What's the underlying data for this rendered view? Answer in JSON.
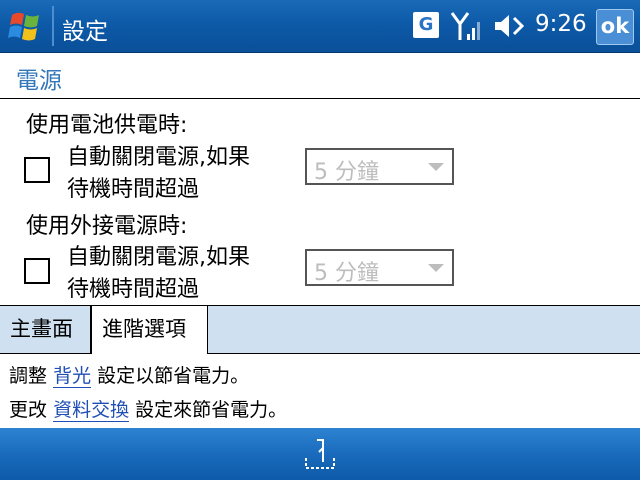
{
  "titlebar": {
    "app_title": "設定",
    "network_badge": "G",
    "clock": "9:26",
    "ok_label": "ok",
    "icons": [
      "windows-start-icon",
      "signal-icon",
      "volume-icon"
    ]
  },
  "page": {
    "title": "電源"
  },
  "battery": {
    "heading": "使用電池供電時:",
    "checkbox_label_line1": "自動關閉電源,如果",
    "checkbox_label_line2": "待機時間超過",
    "checked": false,
    "dropdown_value": "5 分鐘"
  },
  "external": {
    "heading": "使用外接電源時:",
    "checkbox_label_line1": "自動關閉電源,如果",
    "checkbox_label_line2": "待機時間超過",
    "checked": false,
    "dropdown_value": "5 分鐘"
  },
  "tabs": [
    {
      "label": "主畫面",
      "active": false
    },
    {
      "label": "進階選項",
      "active": true
    }
  ],
  "notes": {
    "line1_prefix": "調整",
    "line1_link": "背光",
    "line1_suffix": "設定以節省電力。",
    "line2_prefix": "更改",
    "line2_link": "資料交換",
    "line2_suffix": "設定來節省電力。"
  },
  "softbar": {
    "icon": "input-panel-icon"
  },
  "colors": {
    "titlebar": "#0d5aa8",
    "accent_title": "#3377bb",
    "tab_bg": "#cfe0f1",
    "link": "#1f4fb4",
    "disabled_text": "#bdbdbd"
  }
}
